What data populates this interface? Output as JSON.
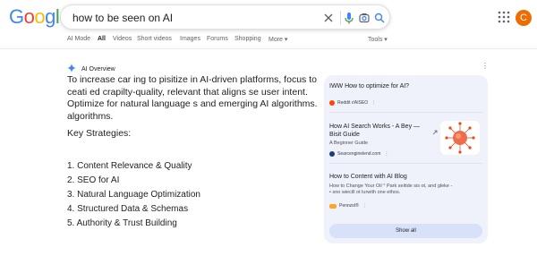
{
  "logo": {
    "letters": [
      "G",
      "o",
      "o",
      "g",
      "l",
      "e"
    ],
    "colors": [
      "#4285F4",
      "#EA4335",
      "#FBBC05",
      "#4285F4",
      "#34A853",
      "#EA4335"
    ]
  },
  "search": {
    "query": "how to be seen on AI"
  },
  "account": {
    "initial": "C",
    "color": "#ef6c00"
  },
  "tabs": [
    "AI Mode",
    "All",
    "Videos",
    "Short videos",
    "Images",
    "Forums",
    "Shopping",
    "More ▾",
    "Tools ▾"
  ],
  "overview": {
    "title": "AI Overview",
    "paragraph": "To increase car ing to pisitize in AI-driven platforms, focus to ceati ed crapilty-quality, relevant that aligns se user intent. Optimize for natural language s and emerging AI algorithms. algorithms.",
    "strategies_heading": "Key Strategies:",
    "strategies": [
      "1. Content Relevance & Quality",
      "2. SEO for AI",
      "3. Natural Language Optimization",
      "4. Structured Data & Schemas",
      "5. Authority & Trust Building"
    ]
  },
  "panel": {
    "question": "IWW How to optimize for AI?",
    "reddit_source": "Reddit r/AISEO",
    "card1": {
      "title_line1": "How AI Search Works - A Bey —",
      "title_line2": "Bisit Guide",
      "subtitle": "A Beginner Guide",
      "source": "Searcenginelend.com"
    },
    "card2": {
      "title": "How to Content with AI Blog",
      "desc_line1": "How to Change Your Oil ° Park seitide sis ot, and gleke -",
      "desc_line2": "• sno wiecill ot lurwith one ethos.",
      "source": "Pennzol®"
    },
    "show_all": "Show all"
  }
}
